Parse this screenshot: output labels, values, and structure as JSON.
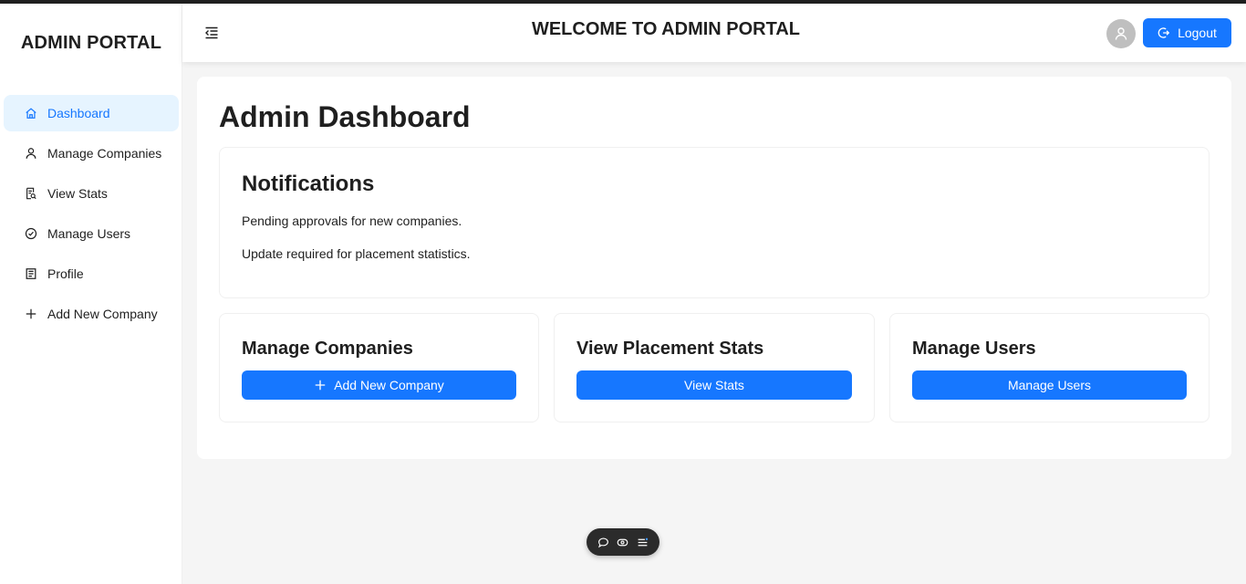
{
  "sidebar": {
    "brand": "ADMIN PORTAL",
    "items": [
      {
        "label": "Dashboard",
        "icon": "home-icon",
        "active": true
      },
      {
        "label": "Manage Companies",
        "icon": "user-icon",
        "active": false
      },
      {
        "label": "View Stats",
        "icon": "file-search-icon",
        "active": false
      },
      {
        "label": "Manage Users",
        "icon": "check-circle-icon",
        "active": false
      },
      {
        "label": "Profile",
        "icon": "profile-icon",
        "active": false
      },
      {
        "label": "Add New Company",
        "icon": "plus-icon",
        "active": false
      }
    ]
  },
  "header": {
    "title": "WELCOME TO ADMIN PORTAL",
    "logout_label": "Logout",
    "collapse_icon": "menu-fold-icon",
    "avatar_icon": "user-icon"
  },
  "main": {
    "page_title": "Admin Dashboard",
    "notifications": {
      "title": "Notifications",
      "lines": [
        "Pending approvals for new companies.",
        "Update required for placement statistics."
      ]
    },
    "cards": [
      {
        "title": "Manage Companies",
        "button": "Add New Company",
        "button_icon": "plus-icon"
      },
      {
        "title": "View Placement Stats",
        "button": "View Stats"
      },
      {
        "title": "Manage Users",
        "button": "Manage Users"
      }
    ]
  },
  "floating_toolbar": {
    "icons": [
      "comment-icon",
      "eye-icon",
      "list-icon"
    ]
  },
  "colors": {
    "primary": "#1677ff",
    "active_bg": "#e6f4ff",
    "page_bg": "#f5f5f5",
    "text": "#1f1f1f"
  }
}
